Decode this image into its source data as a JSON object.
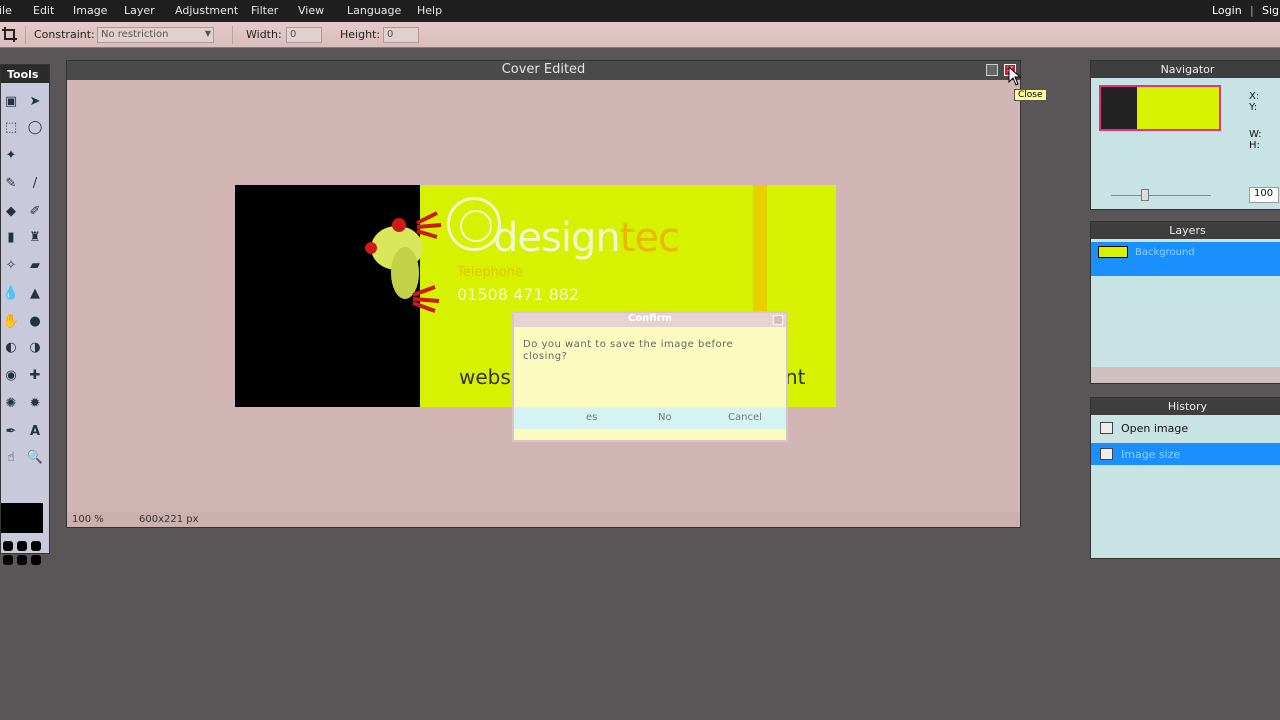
{
  "menu": {
    "items": [
      "ile",
      "Edit",
      "Image",
      "Layer",
      "Adjustment",
      "Filter",
      "View",
      "Language",
      "Help"
    ],
    "login": "Login",
    "separator": "|",
    "signup": "Sig"
  },
  "options": {
    "constraint_label": "Constraint:",
    "constraint_value": "No restriction",
    "width_label": "Width:",
    "width_value": "0",
    "height_label": "Height:",
    "height_value": "0"
  },
  "tools": {
    "title": "Tools",
    "text_tool": "A"
  },
  "document": {
    "title": "Cover Edited",
    "tooltip": "Close",
    "zoom": "100 %",
    "size": "600x221 px"
  },
  "canvas": {
    "brand_main": "design",
    "brand_accent": "tec",
    "telephone_label": "Telephone",
    "telephone_number": "01508 471 882",
    "web_left": "webs",
    "web_right": "nt"
  },
  "dialog": {
    "title": "Confirm",
    "message": "Do you want to save the image before closing?",
    "yes": "es",
    "no": "No",
    "cancel": "Cancel"
  },
  "navigator": {
    "title": "Navigator",
    "x_label": "X:",
    "y_label": "Y:",
    "w_label": "W:",
    "h_label": "H:",
    "zoom_value": "100"
  },
  "layers": {
    "title": "Layers",
    "items": [
      "Background"
    ]
  },
  "history": {
    "title": "History",
    "items": [
      "Open image",
      "Image size"
    ]
  },
  "colors": {
    "accent_blue": "#1a90ff",
    "canvas_yellow": "#d6f200",
    "close_red": "#d42020"
  }
}
